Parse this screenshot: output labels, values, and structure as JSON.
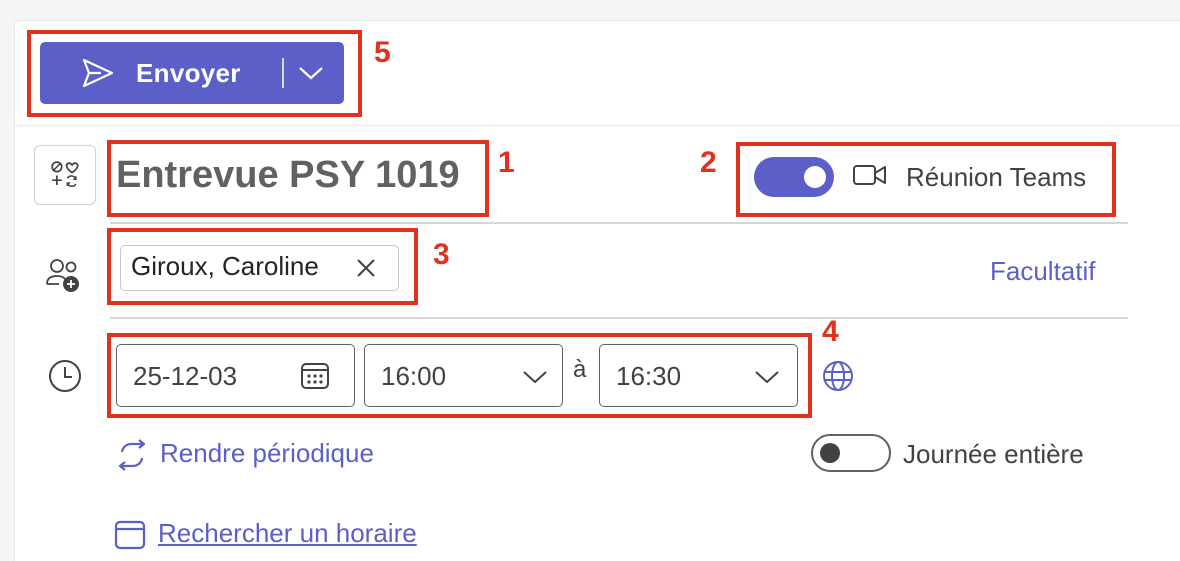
{
  "toolbar": {
    "send_label": "Envoyer"
  },
  "event": {
    "title": "Entrevue PSY 1019",
    "teams_toggle": {
      "on": true,
      "label": "Réunion Teams"
    },
    "attendees": [
      {
        "name": "Giroux, Caroline"
      }
    ],
    "optional_label": "Facultatif",
    "date": "25-12-03",
    "start_time": "16:00",
    "to_label": "à",
    "end_time": "16:30",
    "recurrence_label": "Rendre périodique",
    "all_day": {
      "on": false,
      "label": "Journée entière"
    },
    "schedule_label": "Rechercher un horaire"
  },
  "callouts": [
    "1",
    "2",
    "3",
    "4",
    "5"
  ],
  "colors": {
    "accent": "#5b5fc7",
    "callout": "#e0321c",
    "title_text": "#616161"
  },
  "icons": {
    "send": "send-icon",
    "dropdown": "chevron-down-icon",
    "title_category": "category-icon",
    "video": "video-camera-icon",
    "attendees": "people-add-icon",
    "remove": "close-icon",
    "clock": "clock-icon",
    "calendar": "calendar-icon",
    "timezone": "globe-icon",
    "repeat": "repeat-icon",
    "schedule": "calendar-search-icon"
  }
}
